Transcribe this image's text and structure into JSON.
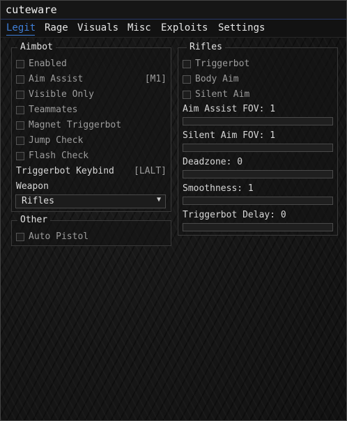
{
  "app": {
    "title": "cuteware"
  },
  "tabs": [
    "Legit",
    "Rage",
    "Visuals",
    "Misc",
    "Exploits",
    "Settings"
  ],
  "active_tab": "Legit",
  "accent_color": "#3f7fd8",
  "aimbot": {
    "title": "Aimbot",
    "items": [
      {
        "label": "Enabled",
        "checked": false,
        "keybind": ""
      },
      {
        "label": "Aim Assist",
        "checked": false,
        "keybind": "[M1]"
      },
      {
        "label": "Visible Only",
        "checked": false,
        "keybind": ""
      },
      {
        "label": "Teammates",
        "checked": false,
        "keybind": ""
      },
      {
        "label": "Magnet Triggerbot",
        "checked": false,
        "keybind": ""
      },
      {
        "label": "Jump Check",
        "checked": false,
        "keybind": ""
      },
      {
        "label": "Flash Check",
        "checked": false,
        "keybind": ""
      }
    ],
    "triggerbot_keybind_label": "Triggerbot Keybind",
    "triggerbot_keybind_value": "[LALT]",
    "weapon_label": "Weapon",
    "weapon_value": "Rifles"
  },
  "other": {
    "title": "Other",
    "items": [
      {
        "label": "Auto Pistol",
        "checked": false
      }
    ]
  },
  "rifles": {
    "title": "Rifles",
    "items": [
      {
        "label": "Triggerbot",
        "checked": false
      },
      {
        "label": "Body Aim",
        "checked": false
      },
      {
        "label": "Silent Aim",
        "checked": false
      }
    ],
    "sliders": [
      {
        "label": "Aim Assist FOV: 1",
        "value": 0
      },
      {
        "label": "Silent Aim FOV: 1",
        "value": 0
      },
      {
        "label": "Deadzone: 0",
        "value": 0
      },
      {
        "label": "Smoothness: 1",
        "value": 0
      },
      {
        "label": "Triggerbot Delay: 0",
        "value": 0
      }
    ]
  }
}
